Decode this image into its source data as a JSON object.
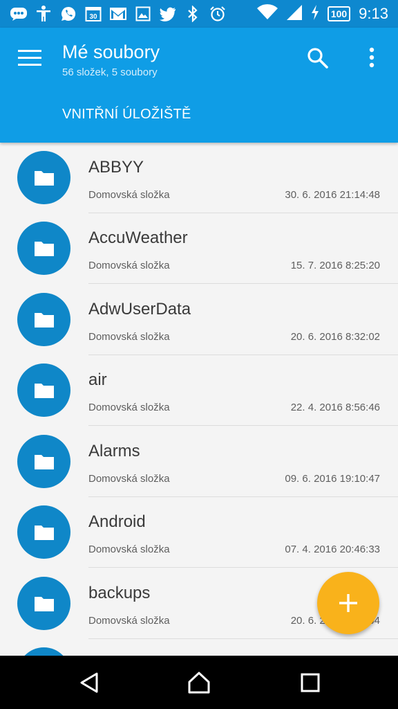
{
  "status_bar": {
    "battery": "100",
    "time": "9:13",
    "icons": [
      "chat-icon",
      "accessibility-icon",
      "whatsapp-icon",
      "calendar-icon",
      "gmail-icon",
      "gallery-icon",
      "twitter-icon",
      "bluetooth-icon",
      "alarm-icon",
      "wifi-icon",
      "signal-icon",
      "charging-icon"
    ]
  },
  "app_bar": {
    "title": "Mé soubory",
    "subtitle": "56 složek, 5 soubory",
    "tab": "VNITŘNÍ ÚLOŽIŠTĚ",
    "color": "#0f9de6"
  },
  "folders": [
    {
      "name": "ABBYY",
      "type": "Domovská složka",
      "date": "30. 6. 2016 21:14:48"
    },
    {
      "name": "AccuWeather",
      "type": "Domovská složka",
      "date": "15. 7. 2016 8:25:20"
    },
    {
      "name": "AdwUserData",
      "type": "Domovská složka",
      "date": "20. 6. 2016 8:32:02"
    },
    {
      "name": "air",
      "type": "Domovská složka",
      "date": "22. 4. 2016 8:56:46"
    },
    {
      "name": "Alarms",
      "type": "Domovská složka",
      "date": "09. 6. 2016 19:10:47"
    },
    {
      "name": "Android",
      "type": "Domovská složka",
      "date": "07. 4. 2016 20:46:33"
    },
    {
      "name": "backups",
      "type": "Domovská složka",
      "date": "20. 6. 2016 8:32:04"
    },
    {
      "name": "",
      "type": "",
      "date": ""
    }
  ],
  "fab": {
    "icon": "plus-icon",
    "color": "#f9b21b"
  },
  "nav_bar": {
    "icons": [
      "back-icon",
      "home-icon",
      "recents-icon"
    ]
  }
}
